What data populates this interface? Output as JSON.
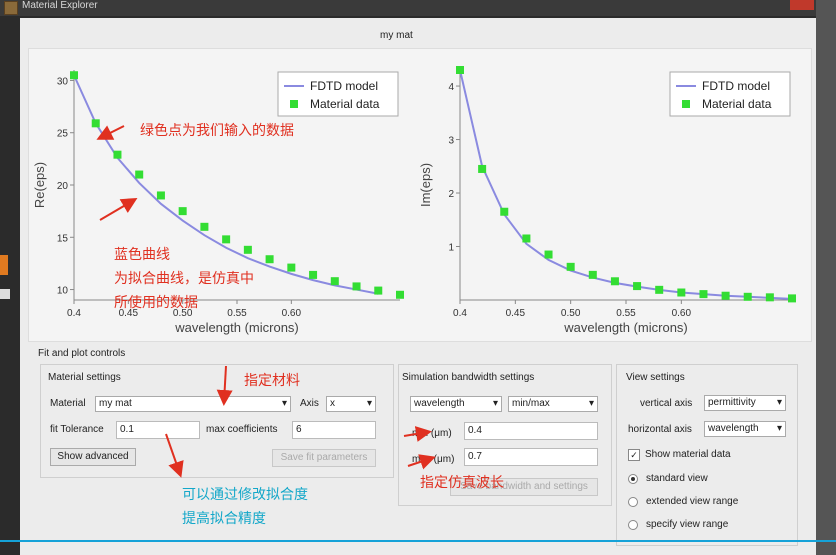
{
  "window": {
    "title": "Material Explorer"
  },
  "plot_title": "my mat",
  "chart_data": [
    {
      "type": "scatter",
      "xlabel": "wavelength (microns)",
      "ylabel": "Re(eps)",
      "xlim": [
        0.4,
        0.7
      ],
      "ylim": [
        9,
        31
      ],
      "x_ticks": [
        "0.4",
        "0.45",
        "0.50",
        "0.55",
        "0.60"
      ],
      "y_ticks": [
        "10",
        "15",
        "20",
        "25",
        "30"
      ],
      "legend": [
        "FDTD model",
        "Material data"
      ],
      "legend_position": "top-right",
      "series": [
        {
          "name": "FDTD model",
          "color": "#8a8ae0",
          "x": [
            0.4,
            0.42,
            0.44,
            0.46,
            0.48,
            0.5,
            0.52,
            0.54,
            0.56,
            0.58,
            0.6,
            0.62,
            0.64,
            0.66,
            0.68
          ],
          "y": [
            30.5,
            25.9,
            22.6,
            20.2,
            18.2,
            16.6,
            15.2,
            14.0,
            13.0,
            12.2,
            11.5,
            10.9,
            10.4,
            10.0,
            9.6
          ]
        },
        {
          "name": "Material data",
          "color": "#33dd33",
          "x": [
            0.4,
            0.42,
            0.44,
            0.46,
            0.48,
            0.5,
            0.52,
            0.54,
            0.56,
            0.58,
            0.6,
            0.62,
            0.64,
            0.66,
            0.68,
            0.7
          ],
          "y": [
            30.5,
            25.9,
            22.9,
            21.0,
            19.0,
            17.5,
            16.0,
            14.8,
            13.8,
            12.9,
            12.1,
            11.4,
            10.8,
            10.3,
            9.9,
            9.5
          ]
        }
      ]
    },
    {
      "type": "scatter",
      "xlabel": "wavelength (microns)",
      "ylabel": "Im(eps)",
      "xlim": [
        0.4,
        0.7
      ],
      "ylim": [
        0,
        4.3
      ],
      "x_ticks": [
        "0.4",
        "0.45",
        "0.50",
        "0.55",
        "0.60"
      ],
      "y_ticks": [
        "1",
        "2",
        "3",
        "4"
      ],
      "legend": [
        "FDTD model",
        "Material data"
      ],
      "legend_position": "top-right",
      "series": [
        {
          "name": "FDTD model",
          "color": "#8a8ae0",
          "x": [
            0.4,
            0.42,
            0.44,
            0.46,
            0.48,
            0.5,
            0.52,
            0.54,
            0.56,
            0.58,
            0.6,
            0.62,
            0.64,
            0.66,
            0.68,
            0.7
          ],
          "y": [
            4.3,
            2.5,
            1.6,
            1.05,
            0.75,
            0.55,
            0.42,
            0.32,
            0.25,
            0.19,
            0.14,
            0.11,
            0.08,
            0.06,
            0.04,
            0.02
          ]
        },
        {
          "name": "Material data",
          "color": "#33dd33",
          "x": [
            0.4,
            0.42,
            0.44,
            0.46,
            0.48,
            0.5,
            0.52,
            0.54,
            0.56,
            0.58,
            0.6,
            0.62,
            0.64,
            0.66,
            0.68,
            0.7
          ],
          "y": [
            4.3,
            2.45,
            1.65,
            1.15,
            0.85,
            0.62,
            0.47,
            0.35,
            0.26,
            0.19,
            0.14,
            0.11,
            0.08,
            0.06,
            0.05,
            0.03
          ]
        }
      ]
    }
  ],
  "controls": {
    "section_title": "Fit and plot controls",
    "material_settings": {
      "title": "Material settings",
      "material_label": "Material",
      "material_value": "my mat",
      "axis_label": "Axis",
      "axis_value": "x",
      "fit_tolerance_label": "fit Tolerance",
      "fit_tolerance_value": "0.1",
      "max_coeff_label": "max coefficients",
      "max_coeff_value": "6",
      "show_advanced": "Show advanced",
      "save_fit": "Save fit parameters"
    },
    "simulation": {
      "title": "Simulation bandwidth settings",
      "wavelength_select": "wavelength",
      "minmax_select": "min/max",
      "min_label": "min (μm)",
      "min_value": "0.4",
      "max_label": "max (μm)",
      "max_value": "0.7",
      "save_button": "Save bandwidth and settings"
    },
    "view": {
      "title": "View settings",
      "vertical_label": "vertical axis",
      "vertical_value": "permittivity",
      "horizontal_label": "horizontal axis",
      "horizontal_value": "wavelength",
      "show_material": "Show material data",
      "show_material_checked": "✓",
      "radio_standard": "standard view",
      "radio_extended": "extended view range",
      "radio_specify": "specify view range"
    }
  },
  "annotations": {
    "green_points": "绿色点为我们输入的数据",
    "blue_curve_1": "蓝色曲线",
    "blue_curve_2": "为拟合曲线，是仿真中",
    "blue_curve_3": "所使用的数据",
    "specify_material": "指定材料",
    "specify_wavelength": "指定仿真波长",
    "improve_1": "可以通过修改拟合度",
    "improve_2": "提高拟合精度"
  }
}
